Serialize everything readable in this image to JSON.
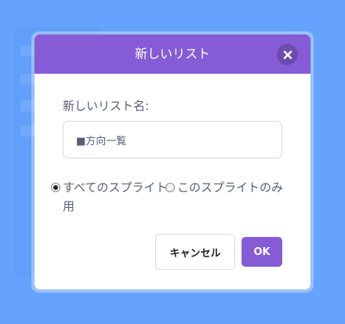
{
  "dialog": {
    "title": "新しいリスト",
    "name_label": "新しいリスト名:",
    "name_value": "■方向一覧",
    "options": [
      {
        "label": "すべてのスプライト用",
        "checked": true
      },
      {
        "label": "このスプライトのみ",
        "checked": false
      }
    ],
    "cancel_label": "キャンセル",
    "ok_label": "OK"
  },
  "colors": {
    "backdrop": "#66a3ff",
    "header": "#855cd6",
    "ok_button": "#855cd6",
    "text": "#575e75"
  },
  "icons": {
    "close": "close-icon"
  }
}
